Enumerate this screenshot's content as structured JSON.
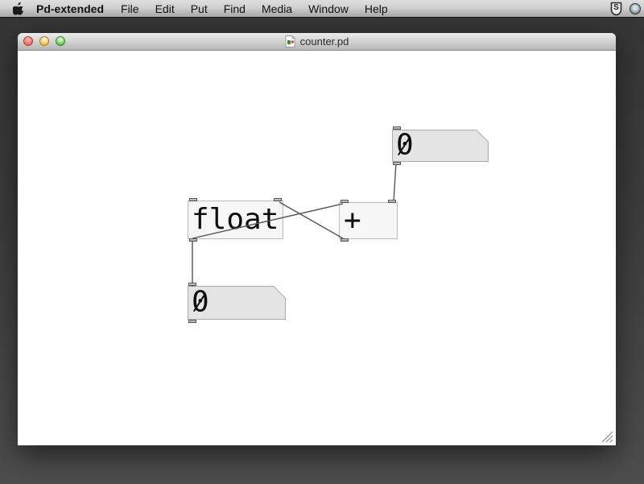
{
  "menubar": {
    "app_name": "Pd-extended",
    "menus": [
      "File",
      "Edit",
      "Put",
      "Find",
      "Media",
      "Window",
      "Help"
    ],
    "status": {
      "shield_glyph": "S"
    }
  },
  "window": {
    "title": "counter.pd"
  },
  "patch": {
    "objects": [
      {
        "id": "num-top",
        "type": "number_box",
        "value": "0"
      },
      {
        "id": "float",
        "type": "object_box",
        "text": "float"
      },
      {
        "id": "plus",
        "type": "object_box",
        "text": "+"
      },
      {
        "id": "num-bottom",
        "type": "number_box",
        "value": "0"
      }
    ],
    "connections": [
      {
        "from": "num-top.outlet",
        "to": "plus.right_inlet"
      },
      {
        "from": "float.outlet",
        "to": "plus.left_inlet"
      },
      {
        "from": "plus.outlet",
        "to": "float.right_inlet"
      },
      {
        "from": "float.outlet",
        "to": "num-bottom.inlet"
      }
    ],
    "colors": {
      "cord": "#4e584e",
      "object_fill": "#f6f6f6",
      "number_fill": "#e4e4e4",
      "border": "#b9b9b9",
      "canvas": "#ffffff"
    }
  }
}
